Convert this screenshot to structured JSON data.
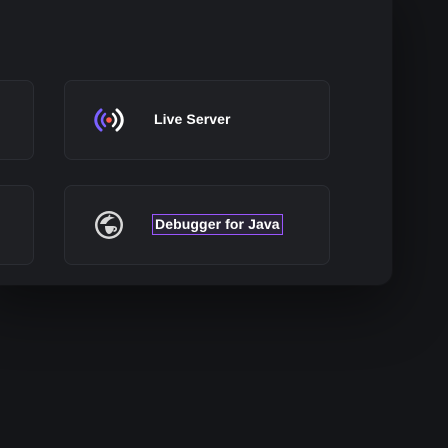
{
  "extensions": [
    {
      "name": "Live Server",
      "icon": "live-server-broadcast-icon"
    },
    {
      "name": "Debugger for Java",
      "icon": "java-debugger-icon"
    }
  ],
  "colors": {
    "background": "#141518",
    "panel": "#1b1c20",
    "card": "#1f2024",
    "card_border": "#2b2d33",
    "highlight_border": "#9a56ff",
    "live_server_accent": "#7b61ff",
    "text": "#ffffff"
  }
}
